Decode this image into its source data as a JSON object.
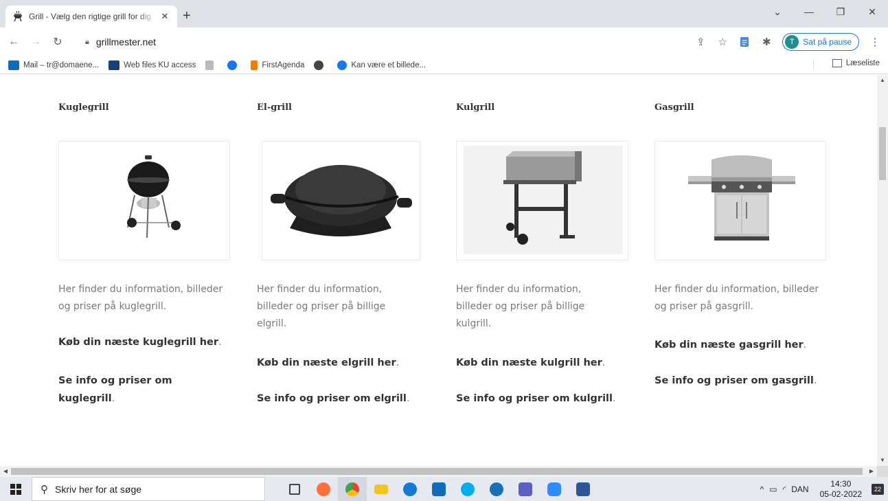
{
  "browser": {
    "tab_title": "Grill - Vælg den rigtige grill for dig",
    "tab_close": "✕",
    "new_tab": "+",
    "url": "grillmester.net",
    "profile_initial": "T",
    "profile_label": "Sat på pause",
    "window_controls": [
      "⌄",
      "—",
      "❐",
      "✕"
    ]
  },
  "bookmarks": {
    "items": [
      {
        "label": "Mail – tr@domaene...",
        "icon": "outlook-icon",
        "color": "#0f6cbd"
      },
      {
        "label": "Web files KU access",
        "icon": "web-files-icon",
        "color": "#1a3d7c"
      },
      {
        "label": "",
        "icon": "bookmark-crest-icon",
        "color": "#888888"
      },
      {
        "label": "",
        "icon": "facebook-icon",
        "color": "#1877f2"
      },
      {
        "label": "FirstAgenda",
        "icon": "bookmark-flag-icon",
        "color": "#f57c00"
      },
      {
        "label": "",
        "icon": "globe-icon",
        "color": "#444444"
      },
      {
        "label": "Kan være et billede...",
        "icon": "facebook-icon",
        "color": "#1877f2"
      }
    ],
    "reading_list": "Læseliste"
  },
  "columns": [
    {
      "title": "Kuglegrill",
      "image": "kettle-grill",
      "description": "Her finder du information, billeder og priser på kuglegrill.",
      "buy_link": "Køb din næste kuglegrill her",
      "info_link": "Se info og priser om kuglegrill"
    },
    {
      "title": "El-grill",
      "image": "electric-grill",
      "description": "Her finder du information, billeder og priser på billige elgrill.",
      "buy_link": "Køb din næste elgrill her",
      "info_link": "Se info og priser om elgrill"
    },
    {
      "title": "Kulgrill",
      "image": "charcoal-grill",
      "description": "Her finder du information, billeder og priser på billige kulgrill.",
      "buy_link": "Køb din næste kulgrill her",
      "info_link": "Se info og priser om kulgrill"
    },
    {
      "title": "Gasgrill",
      "image": "gas-grill",
      "description": "Her finder du information, billeder og priser på gasgrill.",
      "buy_link": "Køb din næste gasgrill her",
      "info_link": "Se info og priser om gasgrill"
    }
  ],
  "taskbar": {
    "search_placeholder": "Skriv her for at søge",
    "language": "DAN",
    "time": "14:30",
    "date": "05-02-2022",
    "notification_count": "22",
    "apps": [
      {
        "name": "task-view-icon",
        "color": "#444444"
      },
      {
        "name": "firefox-icon",
        "color": "#ff7139"
      },
      {
        "name": "chrome-icon",
        "color": "#4285f4"
      },
      {
        "name": "file-explorer-icon",
        "color": "#f5c518"
      },
      {
        "name": "edge-icon",
        "color": "#0f7bd7"
      },
      {
        "name": "outlook-icon",
        "color": "#0f6cbd"
      },
      {
        "name": "skype-icon",
        "color": "#00aff0"
      },
      {
        "name": "skype-business-icon",
        "color": "#1572b6"
      },
      {
        "name": "teams-icon",
        "color": "#5b5fc7"
      },
      {
        "name": "zoom-icon",
        "color": "#2d8cff"
      },
      {
        "name": "word-icon",
        "color": "#2b579a"
      }
    ]
  }
}
